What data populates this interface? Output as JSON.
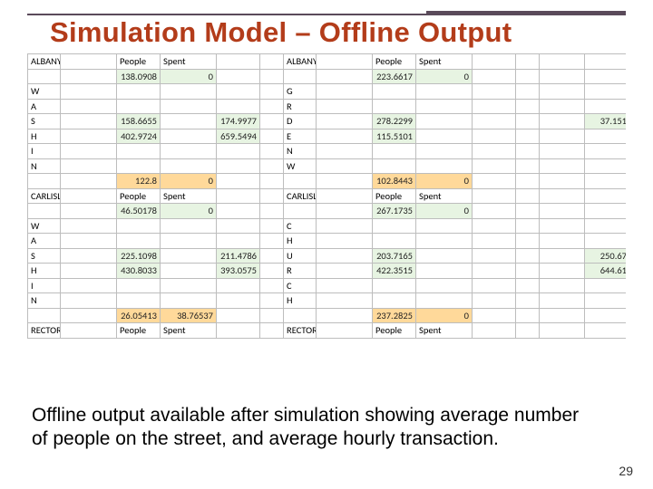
{
  "title": "Simulation Model – Offline Output",
  "caption": "Offline output available after simulation showing average number of people on the street, and average hourly transaction.",
  "page_number": "29",
  "labels": {
    "people": "People",
    "spent": "Spent"
  },
  "blocks": [
    {
      "name": "ALBANY",
      "row_labels": [
        "W",
        "A",
        "S",
        "H",
        "I",
        "N"
      ],
      "left": {
        "top_people": "138.0908",
        "top_spent": "0",
        "rows": [
          [
            "",
            ""
          ],
          [
            "",
            ""
          ],
          [
            "158.6655",
            ""
          ],
          [
            "402.9724",
            ""
          ],
          [
            "",
            ""
          ],
          [
            "",
            ""
          ]
        ],
        "bottom": [
          "122.8",
          "0"
        ]
      },
      "right_letters": [
        "G",
        "R",
        "D",
        "E",
        "N",
        "W"
      ],
      "right": {
        "top_people": "223.6617",
        "top_spent": "0",
        "rows": [
          [
            "",
            ""
          ],
          [
            "",
            ""
          ],
          [
            "278.2299",
            ""
          ],
          [
            "115.5101",
            ""
          ],
          [
            "",
            ""
          ],
          [
            "",
            ""
          ]
        ],
        "bottom": [
          "102.8443",
          "0"
        ]
      },
      "far": {
        "top_people": "",
        "top_spent": "",
        "rows": [
          [
            "",
            ""
          ],
          [
            "",
            ""
          ],
          [
            "",
            "37.151"
          ],
          [
            "",
            ""
          ],
          [
            "",
            ""
          ],
          [
            "",
            ""
          ]
        ],
        "bottom": [
          "",
          ""
        ]
      }
    },
    {
      "name": "CARLISLE",
      "row_labels": [
        "W",
        "A",
        "S",
        "H",
        "I",
        "N"
      ],
      "left": {
        "top_people": "46.50178",
        "top_spent": "0",
        "rows": [
          [
            "",
            ""
          ],
          [
            "",
            ""
          ],
          [
            "225.1098",
            ""
          ],
          [
            "430.8033",
            ""
          ],
          [
            "",
            ""
          ],
          [
            "",
            ""
          ]
        ],
        "bottom": [
          "26.05413",
          "38.76537"
        ]
      },
      "right_letters": [
        "C",
        "H",
        "U",
        "R",
        "C",
        "H"
      ],
      "right": {
        "top_people": "267.1735",
        "top_spent": "0",
        "rows": [
          [
            "",
            ""
          ],
          [
            "",
            ""
          ],
          [
            "203.7165",
            ""
          ],
          [
            "422.3515",
            ""
          ],
          [
            "",
            ""
          ],
          [
            "",
            ""
          ]
        ],
        "bottom": [
          "237.2825",
          "0"
        ]
      },
      "far": {
        "top_people": "",
        "top_spent": "",
        "rows": [
          [
            "",
            ""
          ],
          [
            "",
            ""
          ],
          [
            "",
            "250.67"
          ],
          [
            "",
            "644.61"
          ],
          [
            "",
            ""
          ],
          [
            "",
            ""
          ]
        ],
        "bottom": [
          "",
          ""
        ]
      }
    },
    {
      "name": "RECTOR",
      "left_mid": {
        "rows": [
          [
            "",
            ""
          ],
          [
            "",
            ""
          ],
          [
            "211.4786",
            ""
          ],
          [
            "393.0575",
            ""
          ],
          [
            "",
            ""
          ],
          [
            "",
            ""
          ]
        ]
      }
    }
  ],
  "left_mid_col": {
    "rows": [
      [
        "174.9977",
        ""
      ],
      [
        "659.5494",
        ""
      ]
    ]
  }
}
